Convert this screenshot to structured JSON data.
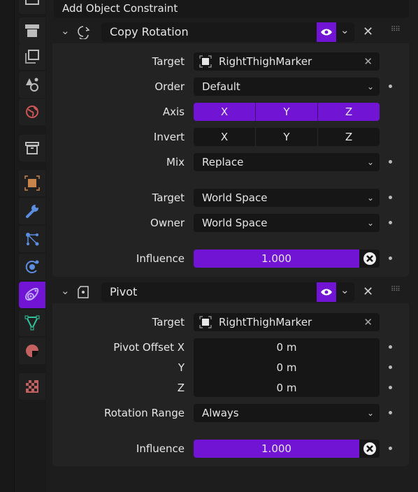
{
  "header": {
    "add_constraint_label": "Add Object Constraint"
  },
  "sidebar": {
    "tabs": [
      "tool",
      "render",
      "output",
      "view-layer",
      "scene",
      "world",
      "collection",
      "object",
      "modifiers",
      "particles",
      "physics",
      "object-constraints",
      "object-data",
      "material",
      "texture"
    ],
    "active": "object-constraints"
  },
  "colors": {
    "accent": "#7214d4",
    "panel": "#232323",
    "field": "#161616"
  },
  "constraints": [
    {
      "name": "Copy Rotation",
      "icon": "copy-rotation-icon",
      "target_label": "Target",
      "target_value": "RightThighMarker",
      "order_label": "Order",
      "order_value": "Default",
      "axis_label": "Axis",
      "axis": [
        "X",
        "Y",
        "Z"
      ],
      "axis_enabled": [
        true,
        true,
        true
      ],
      "invert_label": "Invert",
      "invert": [
        "X",
        "Y",
        "Z"
      ],
      "invert_enabled": [
        false,
        false,
        false
      ],
      "mix_label": "Mix",
      "mix_value": "Replace",
      "target_space_label": "Target",
      "target_space": "World Space",
      "owner_space_label": "Owner",
      "owner_space": "World Space",
      "influence_label": "Influence",
      "influence": "1.000"
    },
    {
      "name": "Pivot",
      "icon": "pivot-icon",
      "target_label": "Target",
      "target_value": "RightThighMarker",
      "offset_x_label": "Pivot Offset X",
      "offset_x": "0 m",
      "offset_y_label": "Y",
      "offset_y": "0 m",
      "offset_z_label": "Z",
      "offset_z": "0 m",
      "range_label": "Rotation Range",
      "range_value": "Always",
      "influence_label": "Influence",
      "influence": "1.000"
    }
  ]
}
